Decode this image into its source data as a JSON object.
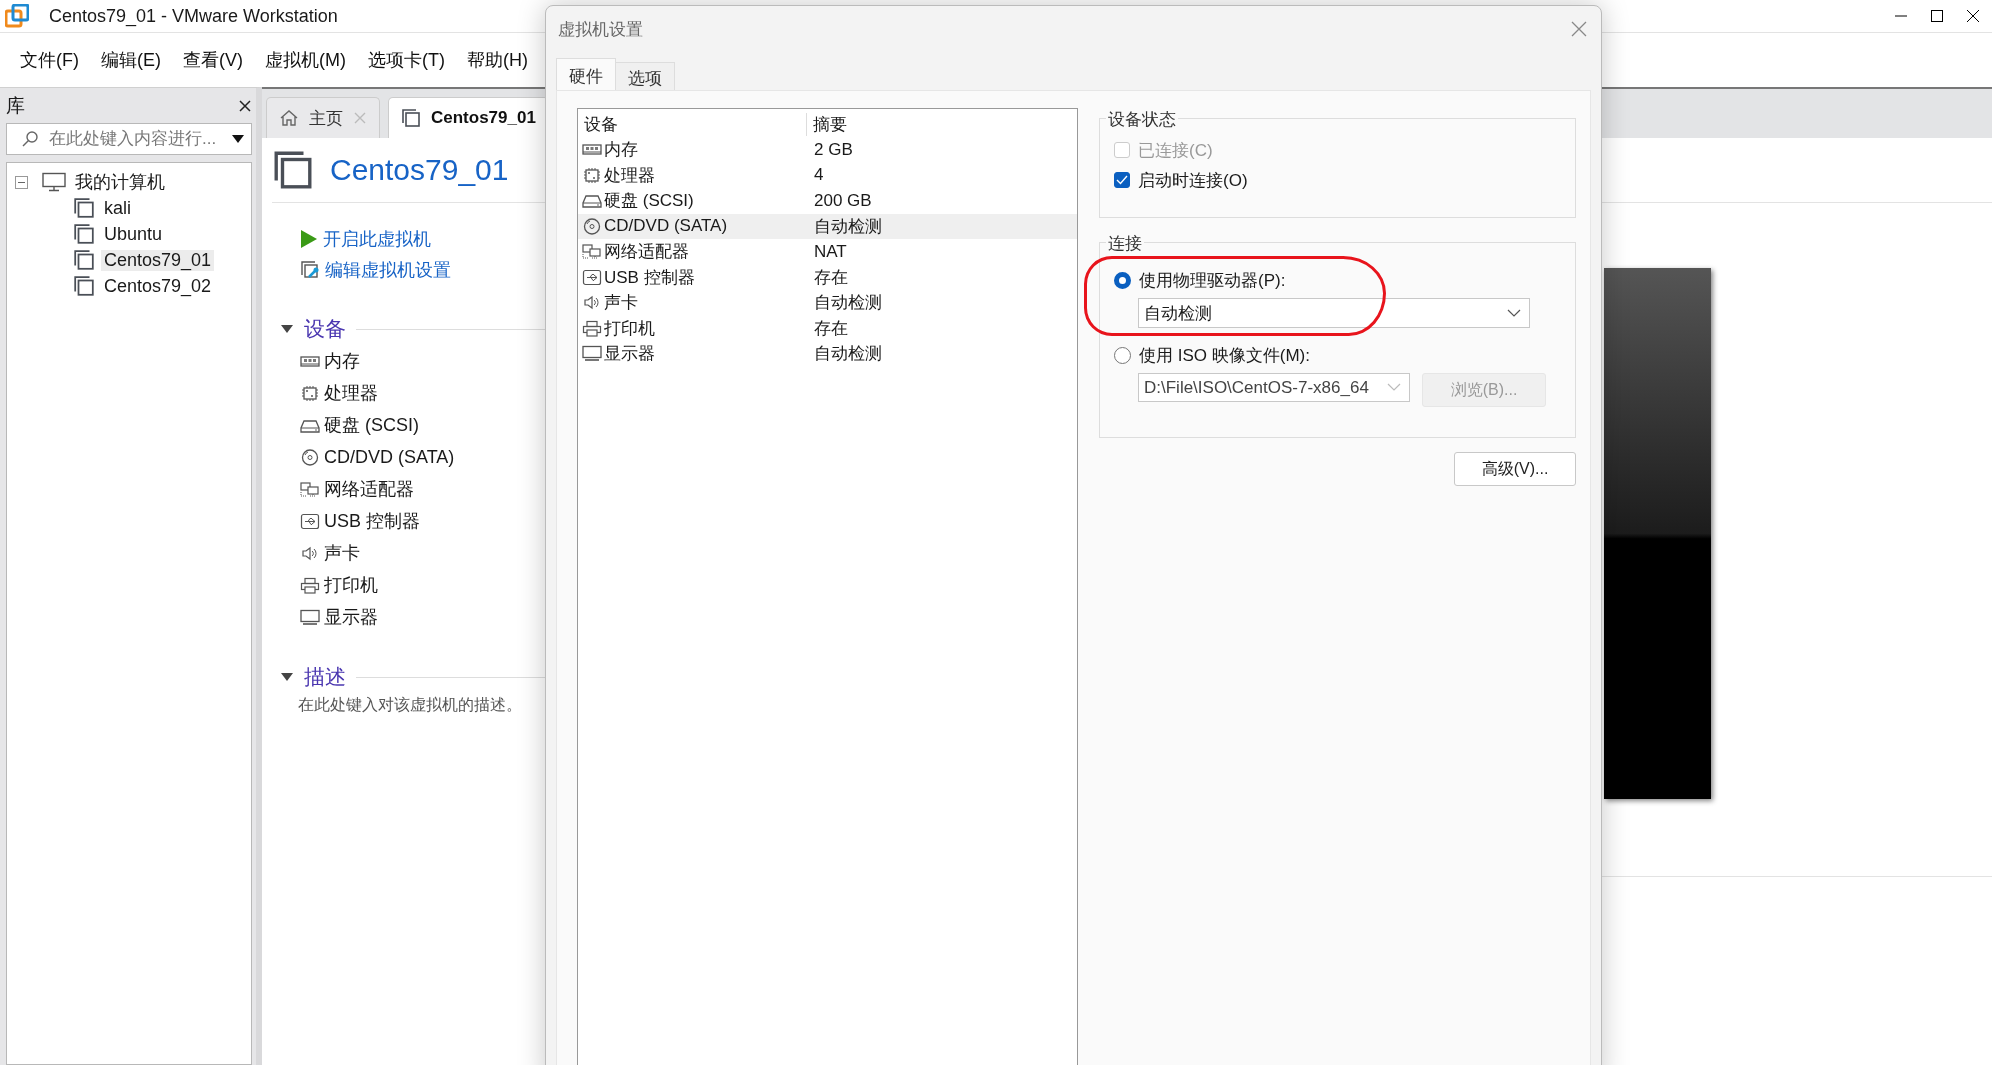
{
  "window": {
    "title": "Centos79_01 - VMware Workstation"
  },
  "menu": [
    {
      "label": "文件(F)"
    },
    {
      "label": "编辑(E)"
    },
    {
      "label": "查看(V)"
    },
    {
      "label": "虚拟机(M)"
    },
    {
      "label": "选项卡(T)"
    },
    {
      "label": "帮助(H)"
    }
  ],
  "library": {
    "title": "库",
    "search": {
      "placeholder": "在此处键入内容进行..."
    },
    "tree": [
      {
        "label": "我的计算机",
        "expanded": true,
        "selected": false,
        "children": [
          {
            "label": "kali",
            "selected": false
          },
          {
            "label": "Ubuntu",
            "selected": false
          },
          {
            "label": "Centos79_01",
            "selected": true
          },
          {
            "label": "Centos79_02",
            "selected": false
          }
        ]
      }
    ]
  },
  "tabs": [
    {
      "kind": "home",
      "label": "主页",
      "selected": false
    },
    {
      "kind": "vm",
      "label": "Centos79_01",
      "selected": true
    }
  ],
  "vm": {
    "name": "Centos79_01",
    "actions": [
      {
        "kind": "power_on",
        "label": "开启此虚拟机"
      },
      {
        "kind": "edit",
        "label": "编辑虚拟机设置"
      }
    ],
    "sections": [
      {
        "kind": "devices",
        "title": "设备",
        "expanded": true,
        "devices": [
          {
            "kind": "memory",
            "label": "内存"
          },
          {
            "kind": "cpu",
            "label": "处理器"
          },
          {
            "kind": "disk",
            "label": "硬盘 (SCSI)"
          },
          {
            "kind": "cdrom",
            "label": "CD/DVD (SATA)"
          },
          {
            "kind": "network",
            "label": "网络适配器"
          },
          {
            "kind": "usb",
            "label": "USB 控制器"
          },
          {
            "kind": "sound",
            "label": "声卡"
          },
          {
            "kind": "printer",
            "label": "打印机"
          },
          {
            "kind": "display",
            "label": "显示器"
          }
        ]
      },
      {
        "kind": "description",
        "title": "描述",
        "expanded": true,
        "text": "在此处键入对该虚拟机的描述。"
      }
    ]
  },
  "dialog": {
    "title": "虚拟机设置",
    "tabs": [
      {
        "label": "硬件",
        "selected": true
      },
      {
        "label": "选项",
        "selected": false
      }
    ],
    "table": {
      "columns": [
        "设备",
        "摘要"
      ],
      "rows": [
        {
          "kind": "memory",
          "device": "内存",
          "summary": "2 GB",
          "selected": false
        },
        {
          "kind": "cpu",
          "device": "处理器",
          "summary": "4",
          "selected": false
        },
        {
          "kind": "disk",
          "device": "硬盘 (SCSI)",
          "summary": "200 GB",
          "selected": false
        },
        {
          "kind": "cdrom",
          "device": "CD/DVD (SATA)",
          "summary": "自动检测",
          "selected": true
        },
        {
          "kind": "network",
          "device": "网络适配器",
          "summary": "NAT",
          "selected": false
        },
        {
          "kind": "usb",
          "device": "USB 控制器",
          "summary": "存在",
          "selected": false
        },
        {
          "kind": "sound",
          "device": "声卡",
          "summary": "自动检测",
          "selected": false
        },
        {
          "kind": "printer",
          "device": "打印机",
          "summary": "存在",
          "selected": false
        },
        {
          "kind": "display",
          "device": "显示器",
          "summary": "自动检测",
          "selected": false
        }
      ]
    },
    "device_status": {
      "title": "设备状态",
      "options": [
        {
          "label": "已连接(C)",
          "checked": false,
          "disabled": true
        },
        {
          "label": "启动时连接(O)",
          "checked": true,
          "disabled": false
        }
      ]
    },
    "connection": {
      "title": "连接",
      "options": [
        {
          "label": "使用物理驱动器(P):",
          "selected": true,
          "dropdown": {
            "value": "自动检测",
            "disabled": false
          }
        },
        {
          "label": "使用 ISO 映像文件(M):",
          "selected": false,
          "dropdown": {
            "value": "D:\\File\\ISO\\CentOS-7-x86_64",
            "disabled": true
          },
          "button": {
            "label": "浏览(B)...",
            "disabled": true
          }
        }
      ]
    },
    "buttons": [
      {
        "label": "高级(V)..."
      }
    ]
  }
}
